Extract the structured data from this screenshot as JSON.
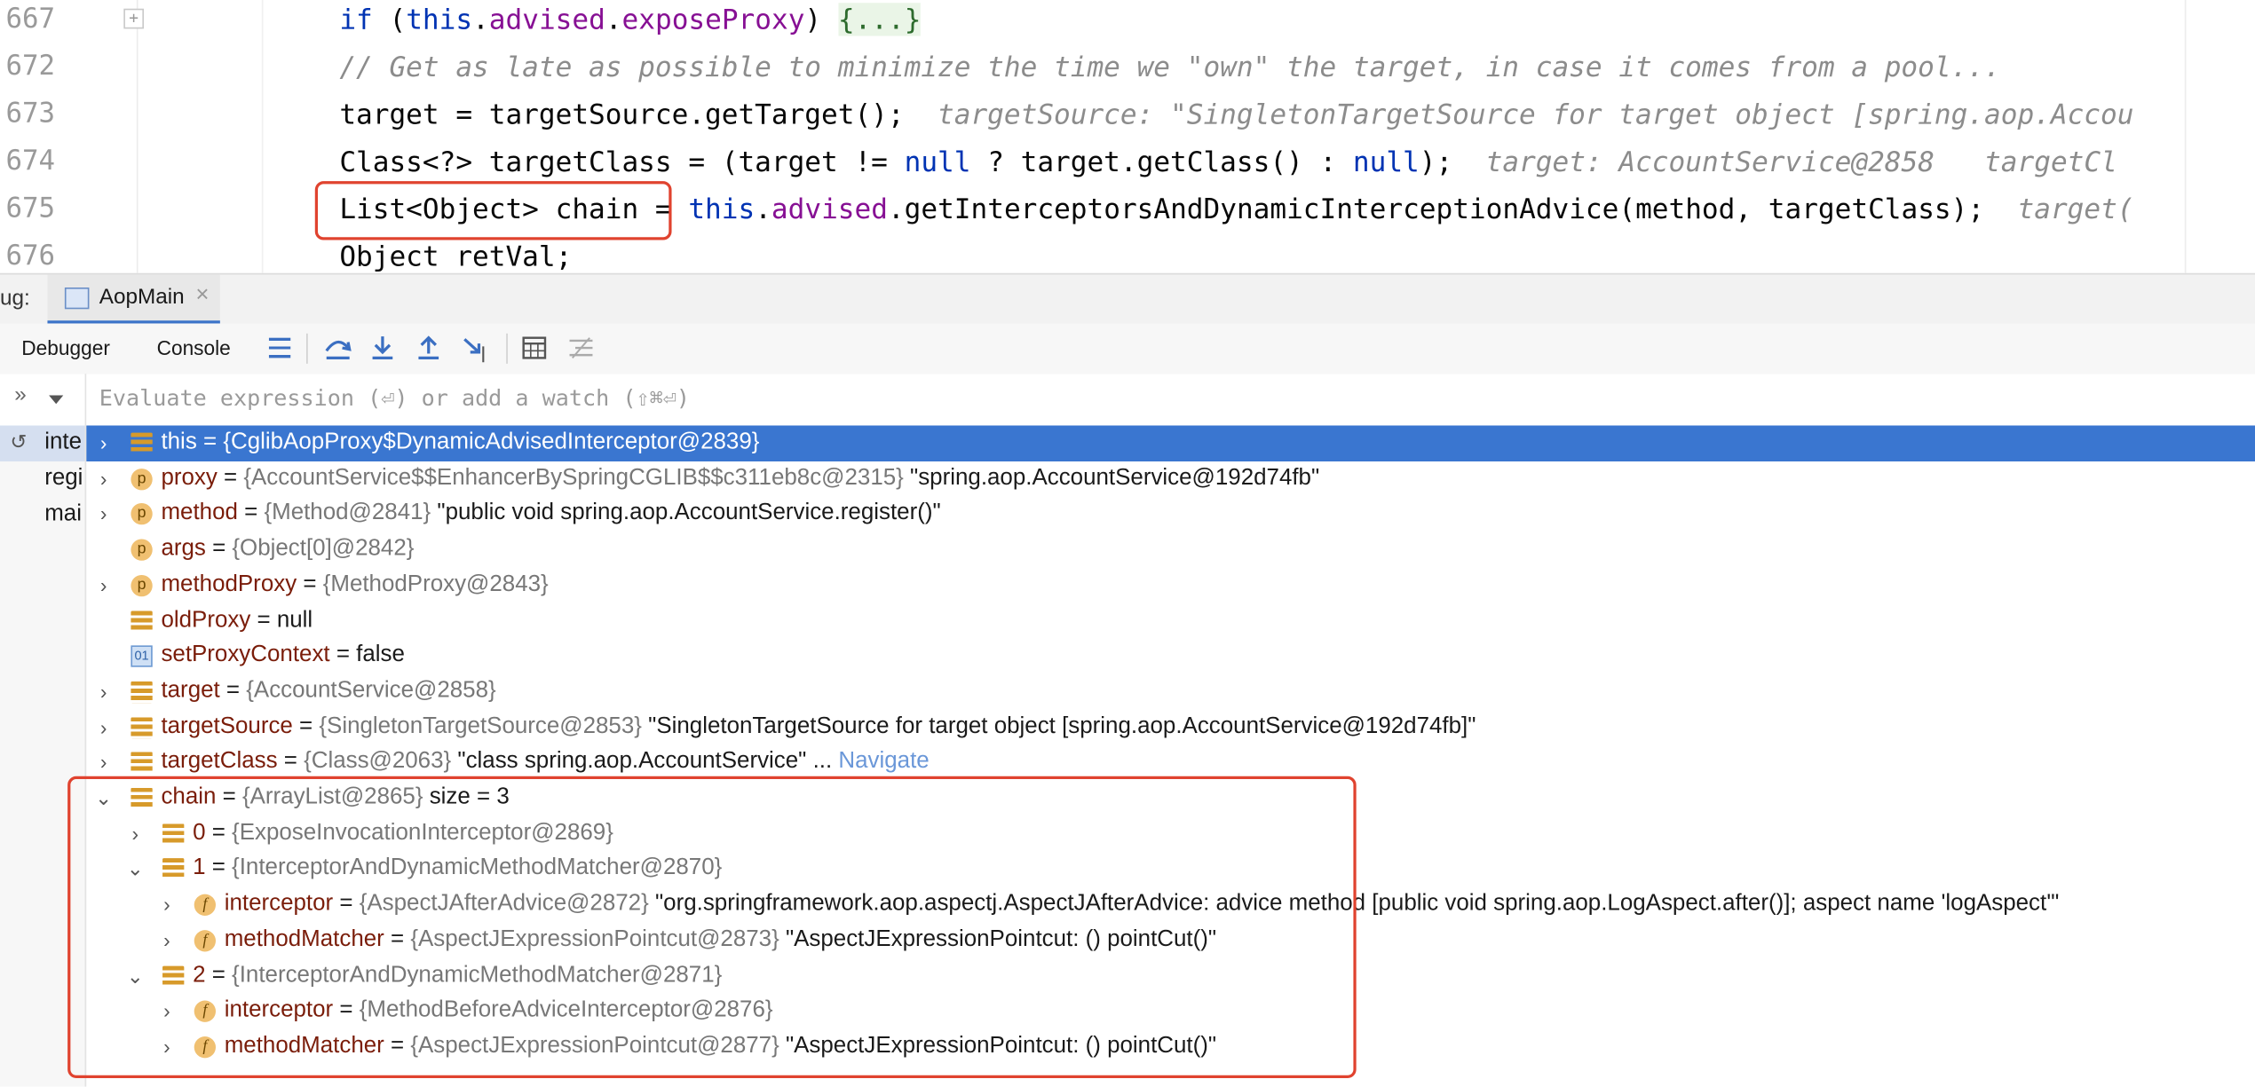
{
  "editor": {
    "line_numbers": [
      "667",
      "672",
      "673",
      "674",
      "675",
      "676"
    ],
    "fold_marker": "+",
    "lines": {
      "l667": {
        "kw1": "if",
        "p1": " (",
        "kw2": "this",
        "p2": ".",
        "f1": "advised",
        "p3": ".",
        "f2": "exposeProxy",
        "p4": ") ",
        "fold": "{...}"
      },
      "l672": "// Get as late as possible to minimize the time we \"own\" the target, in case it comes from a pool...",
      "l673": {
        "code": "target = targetSource.getTarget();",
        "hint": "targetSource: \"SingletonTargetSource for target object [spring.aop.Accou"
      },
      "l674": {
        "a": "Class<?> targetClass = (target != ",
        "kw1": "null",
        "b": " ? target.getClass() : ",
        "kw2": "null",
        "c": ");",
        "hint": "target: AccountService@2858   targetCl"
      },
      "l675": {
        "a": "List<Object> chain",
        "b": " = ",
        "kw": "this",
        "c": ".",
        "f": "advised",
        "d": ".getInterceptorsAndDynamicInterceptionAdvice(method, targetClass);",
        "hint": "target("
      },
      "l676": "Object retVal;"
    }
  },
  "debug": {
    "label": "ug:",
    "tab": "AopMain",
    "close": "×",
    "subtabs": [
      "Debugger",
      "Console"
    ],
    "watch_placeholder": "Evaluate expression (⏎) or add a watch (⇧⌘⏎)",
    "frames": [
      "inte",
      "regi",
      "mai"
    ]
  },
  "variables": [
    {
      "arrow": "›",
      "icon": "list",
      "name": "this",
      "eq": " = ",
      "type": "{CglibAopProxy$DynamicAdvisedInterceptor@2839}",
      "value": "",
      "selected": true
    },
    {
      "arrow": "›",
      "icon": "p",
      "name": "proxy",
      "eq": " = ",
      "type": "{AccountService$$EnhancerBySpringCGLIB$$c311eb8c@2315}",
      "value": " \"spring.aop.AccountService@192d74fb\""
    },
    {
      "arrow": "›",
      "icon": "p",
      "name": "method",
      "eq": " = ",
      "type": "{Method@2841}",
      "value": " \"public void spring.aop.AccountService.register()\""
    },
    {
      "arrow": "",
      "icon": "p",
      "name": "args",
      "eq": " = ",
      "type": "{Object[0]@2842}",
      "value": ""
    },
    {
      "arrow": "›",
      "icon": "p",
      "name": "methodProxy",
      "eq": " = ",
      "type": "{MethodProxy@2843}",
      "value": ""
    },
    {
      "arrow": "",
      "icon": "list",
      "name": "oldProxy",
      "eq": " = ",
      "type": "",
      "value": "null"
    },
    {
      "arrow": "",
      "icon": "01",
      "name": "setProxyContext",
      "eq": " = ",
      "type": "",
      "value": "false"
    },
    {
      "arrow": "›",
      "icon": "list",
      "name": "target",
      "eq": " = ",
      "type": "{AccountService@2858}",
      "value": ""
    },
    {
      "arrow": "›",
      "icon": "list",
      "name": "targetSource",
      "eq": " = ",
      "type": "{SingletonTargetSource@2853}",
      "value": " \"SingletonTargetSource for target object [spring.aop.AccountService@192d74fb]\""
    },
    {
      "arrow": "›",
      "icon": "list",
      "name": "targetClass",
      "eq": " = ",
      "type": "{Class@2063}",
      "value": " \"class spring.aop.AccountService\"",
      "extra": " ... ",
      "nav": "Navigate"
    },
    {
      "arrow": "⌄",
      "icon": "list",
      "name": "chain",
      "eq": " = ",
      "type": "{ArrayList@2865}",
      "value": "  size = 3"
    },
    {
      "arrow": "›",
      "icon": "list",
      "name": "0",
      "eq": " = ",
      "type": "{ExposeInvocationInterceptor@2869}",
      "value": ""
    },
    {
      "arrow": "⌄",
      "icon": "list",
      "name": "1",
      "eq": " = ",
      "type": "{InterceptorAndDynamicMethodMatcher@2870}",
      "value": ""
    },
    {
      "arrow": "›",
      "icon": "f",
      "name": "interceptor",
      "eq": " = ",
      "type": "{AspectJAfterAdvice@2872}",
      "value": " \"org.springframework.aop.aspectj.AspectJAfterAdvice: advice method [public void spring.aop.LogAspect.after()]; aspect name 'logAspect'\""
    },
    {
      "arrow": "›",
      "icon": "f",
      "name": "methodMatcher",
      "eq": " = ",
      "type": "{AspectJExpressionPointcut@2873}",
      "value": " \"AspectJExpressionPointcut: () pointCut()\""
    },
    {
      "arrow": "⌄",
      "icon": "list",
      "name": "2",
      "eq": " = ",
      "type": "{InterceptorAndDynamicMethodMatcher@2871}",
      "value": ""
    },
    {
      "arrow": "›",
      "icon": "f",
      "name": "interceptor",
      "eq": " = ",
      "type": "{MethodBeforeAdviceInterceptor@2876}",
      "value": ""
    },
    {
      "arrow": "›",
      "icon": "f",
      "name": "methodMatcher",
      "eq": " = ",
      "type": "{AspectJExpressionPointcut@2877}",
      "value": " \"AspectJExpressionPointcut: () pointCut()\""
    }
  ],
  "colors": {
    "selection": "#3a76d0",
    "highlight_box": "#e0432f",
    "keyword": "#0033b3",
    "field": "#871094"
  }
}
